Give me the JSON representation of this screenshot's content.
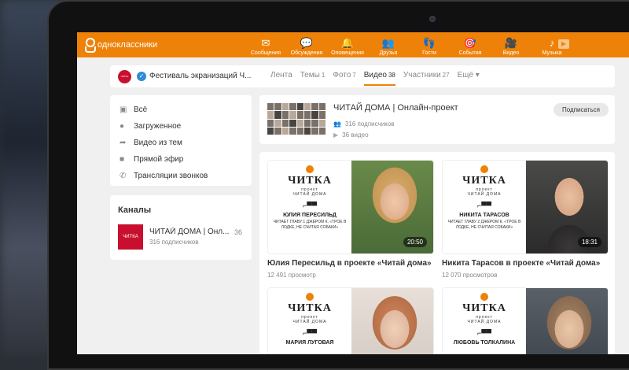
{
  "header": {
    "logo_text": "одноклассники",
    "nav": [
      {
        "label": "Сообщения",
        "icon": "envelope-icon"
      },
      {
        "label": "Обсуждения",
        "icon": "chat-bubbles-icon"
      },
      {
        "label": "Оповещения",
        "icon": "bell-icon"
      },
      {
        "label": "Друзья",
        "icon": "people-icon"
      },
      {
        "label": "Гости",
        "icon": "footprints-icon"
      },
      {
        "label": "События",
        "icon": "events-icon"
      },
      {
        "label": "Видео",
        "icon": "video-camera-icon"
      },
      {
        "label": "Музыка",
        "icon": "music-note-icon"
      }
    ]
  },
  "group": {
    "name": "Фестиваль экранизаций Ч...",
    "tabs": [
      {
        "label": "Лента",
        "count": ""
      },
      {
        "label": "Темы",
        "count": "1"
      },
      {
        "label": "Фото",
        "count": "7"
      },
      {
        "label": "Видео",
        "count": "38"
      },
      {
        "label": "Участники",
        "count": "27"
      },
      {
        "label": "Ещё ▾",
        "count": ""
      }
    ]
  },
  "left_menu": [
    {
      "label": "Всё",
      "icon": "all-videos-icon"
    },
    {
      "label": "Загруженное",
      "icon": "upload-icon"
    },
    {
      "label": "Видео из тем",
      "icon": "share-arrow-icon"
    },
    {
      "label": "Прямой эфир",
      "icon": "live-camera-icon"
    },
    {
      "label": "Трансляции звонков",
      "icon": "phone-icon"
    }
  ],
  "channels": {
    "title": "Каналы",
    "items": [
      {
        "logo": "ЧИТКА",
        "name": "ЧИТАЙ ДОМА | Онл...",
        "subscribers": "316 подписчиков",
        "count": "36"
      }
    ]
  },
  "channel_card": {
    "title": "ЧИТАЙ ДОМА | Онлайн-проект",
    "subscribers": "316 подписчиков",
    "videos": "36 видео",
    "subscribe_label": "Подписаться"
  },
  "videos": [
    {
      "brand": "ЧИТКА",
      "sub1": "проект",
      "sub2": "ЧИТАЙ ДОМА",
      "person": "ЮЛИЯ ПЕРЕСИЛЬД",
      "desc": "ЧИТАЕТ ГЛАВУ 1 ДЖЕРОМ К. «ТРОЕ В ЛОДКЕ, НЕ СЧИТАЯ СОБАКИ»",
      "duration": "20:50",
      "title": "Юлия Пересильд в проекте «Читай дома»",
      "views": "12 491 просмотр"
    },
    {
      "brand": "ЧИТКА",
      "sub1": "проект",
      "sub2": "ЧИТАЙ ДОМА",
      "person": "НИКИТА ТАРАСОВ",
      "desc": "ЧИТАЕТ ГЛАВУ 2 ДЖЕРОМ К. «ТРОЕ В ЛОДКЕ, НЕ СЧИТАЯ СОБАКИ»",
      "duration": "18:31",
      "title": "Никита Тарасов в проекте «Читай дома»",
      "views": "12 070 просмотров"
    },
    {
      "brand": "ЧИТКА",
      "sub1": "проект",
      "sub2": "ЧИТАЙ ДОМА",
      "person": "МАРИЯ ЛУГОВАЯ",
      "desc": "",
      "duration": "",
      "title": "",
      "views": ""
    },
    {
      "brand": "ЧИТКА",
      "sub1": "проект",
      "sub2": "ЧИТАЙ ДОМА",
      "person": "ЛЮБОВЬ ТОЛКАЛИНА",
      "desc": "",
      "duration": "",
      "title": "",
      "views": ""
    }
  ],
  "colors": {
    "accent": "#ee8208",
    "verified": "#2e8bd8",
    "brand_red": "#c8102e"
  }
}
